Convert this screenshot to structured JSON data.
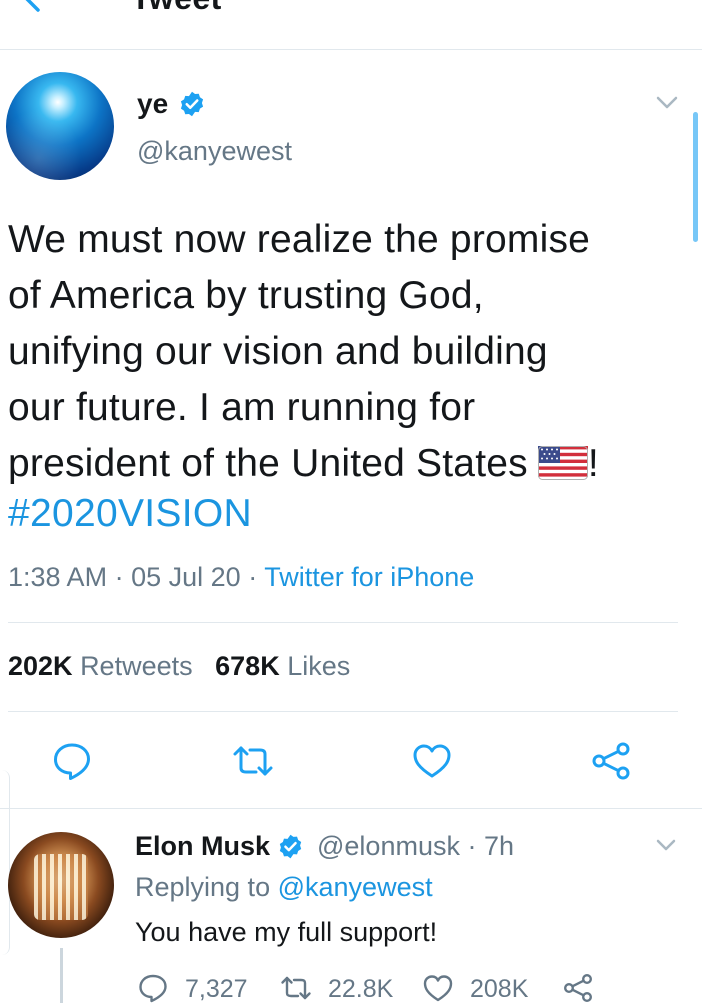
{
  "header": {
    "title": "Tweet"
  },
  "tweet": {
    "author_name": "ye",
    "author_handle": "@kanyewest",
    "text_lines": [
      "We must now realize the promise",
      "of America by trusting God,",
      "unifying our vision and building",
      "our future. I am running for",
      "president of the United States"
    ],
    "text_tail": "!",
    "hashtag": "#2020VISION",
    "time": "1:38 AM",
    "date": "05 Jul 20",
    "separator": "·",
    "source": "Twitter for iPhone",
    "retweets_count": "202K",
    "retweets_label": "Retweets",
    "likes_count": "678K",
    "likes_label": "Likes"
  },
  "reply": {
    "author_name": "Elon Musk",
    "author_handle": "@elonmusk",
    "age": "7h",
    "replying_prefix": "Replying to",
    "replying_to": "@kanyewest",
    "text": "You have my full support!",
    "reply_count": "7,327",
    "retweet_count": "22.8K",
    "like_count": "208K"
  },
  "colors": {
    "accent": "#1da1f2",
    "link": "#1b95e0",
    "muted": "#657786",
    "text": "#14171a",
    "divider": "#e1e8ed"
  },
  "icons": [
    "back-arrow-icon",
    "verified-badge-icon",
    "chevron-down-icon",
    "reply-icon",
    "retweet-icon",
    "like-heart-icon",
    "share-icon",
    "us-flag-emoji-icon"
  ]
}
